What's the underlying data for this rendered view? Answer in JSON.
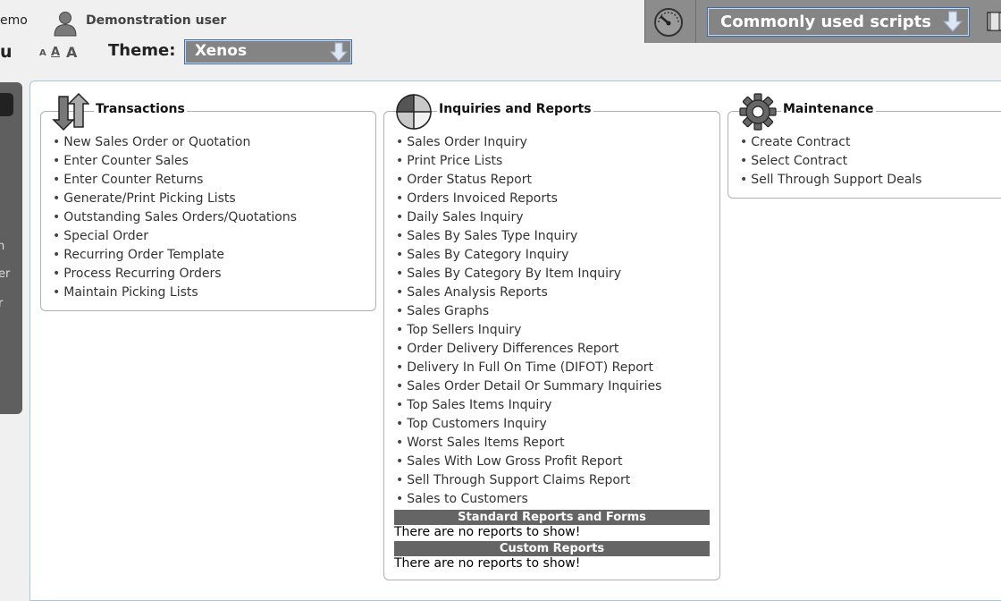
{
  "header": {
    "company_fragment": "emo",
    "user_name": "Demonstration user",
    "menu_fragment": "u",
    "font_sizes": [
      "A",
      "A",
      "A"
    ],
    "theme_label": "Theme:",
    "theme_value": "Xenos",
    "scripts_value": "Commonly used scripts"
  },
  "left_menu": {
    "fragments": [
      "n",
      "er",
      "r"
    ]
  },
  "groups": {
    "transactions": {
      "title": "Transactions",
      "icon": "up-down-arrows-icon",
      "items": [
        "New Sales Order or Quotation",
        "Enter Counter Sales",
        "Enter Counter Returns",
        "Generate/Print Picking Lists",
        "Outstanding Sales Orders/Quotations",
        "Special Order",
        "Recurring Order Template",
        "Process Recurring Orders",
        "Maintain Picking Lists"
      ]
    },
    "inquiries": {
      "title": "Inquiries and Reports",
      "icon": "pie-chart-icon",
      "items": [
        "Sales Order Inquiry",
        "Print Price Lists",
        "Order Status Report",
        "Orders Invoiced Reports",
        "Daily Sales Inquiry",
        "Sales By Sales Type Inquiry",
        "Sales By Category Inquiry",
        "Sales By Category By Item Inquiry",
        "Sales Analysis Reports",
        "Sales Graphs",
        "Top Sellers Inquiry",
        "Order Delivery Differences Report",
        "Delivery In Full On Time (DIFOT) Report",
        "Sales Order Detail Or Summary Inquiries",
        "Top Sales Items Inquiry",
        "Top Customers Inquiry",
        "Worst Sales Items Report",
        "Sales With Low Gross Profit Report",
        "Sell Through Support Claims Report",
        "Sales to Customers"
      ],
      "standard_reports_title": "Standard Reports and Forms",
      "standard_reports_empty": "There are no reports to show!",
      "custom_reports_title": "Custom Reports",
      "custom_reports_empty": "There are no reports to show!"
    },
    "maintenance": {
      "title": "Maintenance",
      "icon": "gear-icon",
      "items": [
        "Create Contract",
        "Select Contract",
        "Sell Through Support Deals"
      ]
    }
  }
}
